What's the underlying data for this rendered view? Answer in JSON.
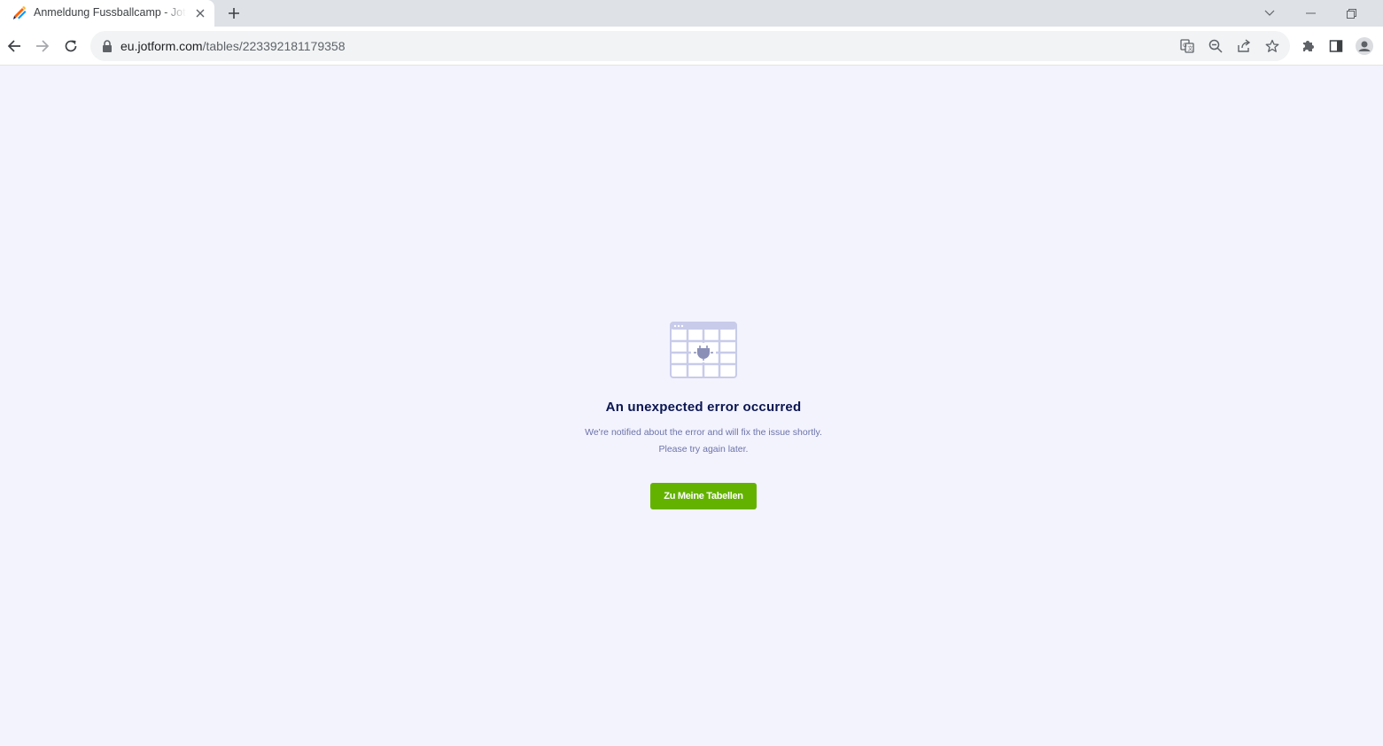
{
  "browser": {
    "tab": {
      "title": "Anmeldung Fussballcamp - Jotform Tables"
    },
    "address_bar": {
      "host": "eu.jotform.com",
      "path": "/tables/223392181179358"
    },
    "icons": {
      "back": "arrow-left-icon",
      "forward": "arrow-right-icon",
      "reload": "reload-icon",
      "lock": "lock-icon",
      "translate": "translate-icon",
      "zoom": "zoom-out-icon",
      "share": "share-icon",
      "bookmark": "star-icon",
      "extensions": "puzzle-icon",
      "side_panel": "side-panel-icon",
      "profile": "profile-icon"
    }
  },
  "page": {
    "error": {
      "title": "An unexpected error occurred",
      "description_line1": "We're notified about the error and will fix the issue shortly.",
      "description_line2": "Please try again later."
    },
    "cta_label": "Zu Meine Tabellen"
  },
  "colors": {
    "page_background": "#f3f3fe",
    "title": "#0a1551",
    "description": "#6c73a8",
    "cta_background": "#64b200",
    "cta_text": "#ffffff",
    "illustration": "#c8cbe9"
  }
}
